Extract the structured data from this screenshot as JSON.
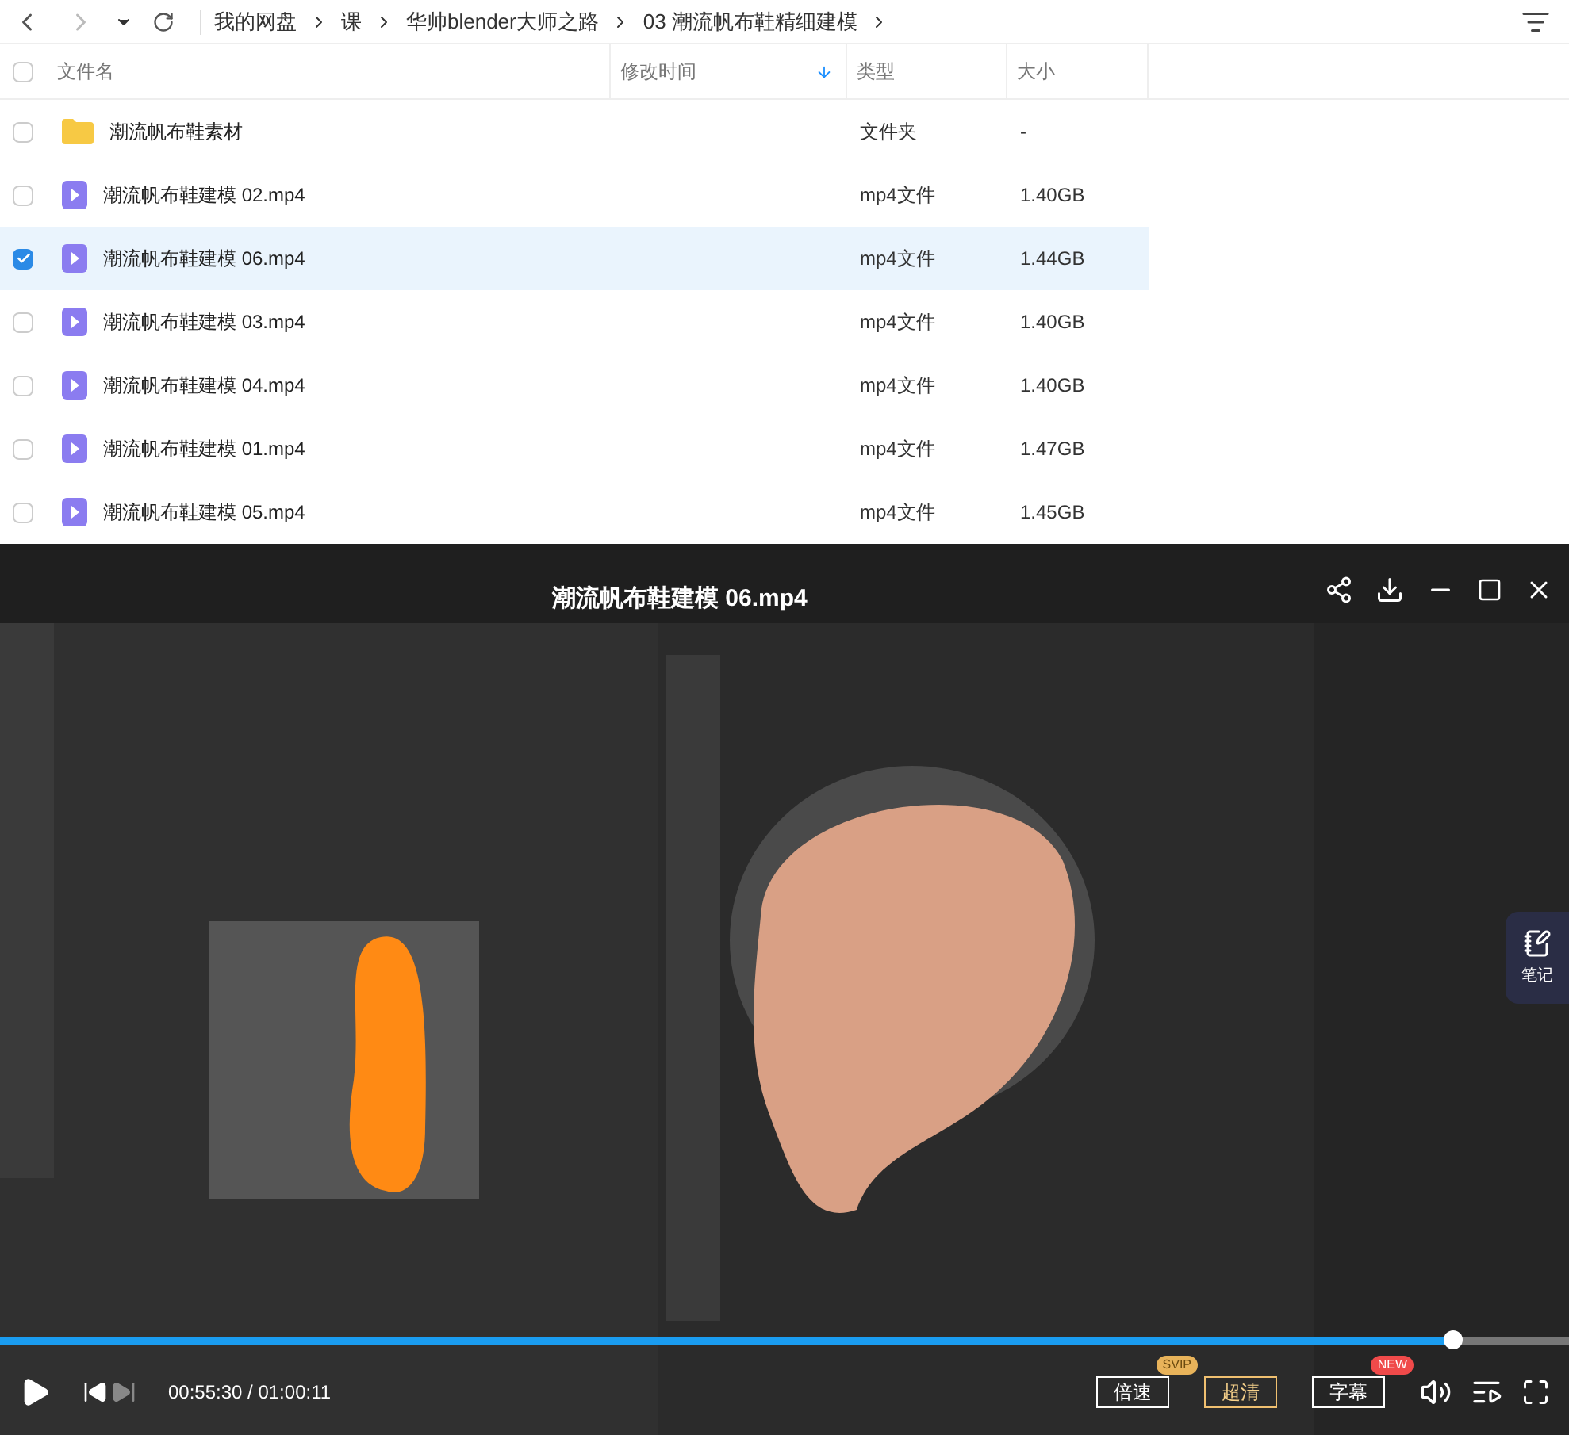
{
  "breadcrumb": [
    "我的网盘",
    "课",
    "华帅blender大师之路",
    "03 潮流帆布鞋精细建模"
  ],
  "table": {
    "columns": [
      {
        "label": "文件名",
        "sorted": false
      },
      {
        "label": "修改时间",
        "sorted": true
      },
      {
        "label": "类型",
        "sorted": false
      },
      {
        "label": "大小",
        "sorted": false
      }
    ],
    "rows": [
      {
        "kind": "folder",
        "name": "潮流帆布鞋素材",
        "type": "文件夹",
        "size": "-",
        "selected": false
      },
      {
        "kind": "video",
        "name": "潮流帆布鞋建模 02.mp4",
        "type": "mp4文件",
        "size": "1.40GB",
        "selected": false
      },
      {
        "kind": "video",
        "name": "潮流帆布鞋建模 06.mp4",
        "type": "mp4文件",
        "size": "1.44GB",
        "selected": true
      },
      {
        "kind": "video",
        "name": "潮流帆布鞋建模 03.mp4",
        "type": "mp4文件",
        "size": "1.40GB",
        "selected": false
      },
      {
        "kind": "video",
        "name": "潮流帆布鞋建模 04.mp4",
        "type": "mp4文件",
        "size": "1.40GB",
        "selected": false
      },
      {
        "kind": "video",
        "name": "潮流帆布鞋建模 01.mp4",
        "type": "mp4文件",
        "size": "1.47GB",
        "selected": false
      },
      {
        "kind": "video",
        "name": "潮流帆布鞋建模 05.mp4",
        "type": "mp4文件",
        "size": "1.45GB",
        "selected": false
      }
    ]
  },
  "player": {
    "title": "潮流帆布鞋建模 06.mp4",
    "progress": {
      "level": 0.926
    },
    "time": "00:55:30 / 01:00:11",
    "buttons": [
      {
        "label": "倍速",
        "badge": "SVIP",
        "highlighted": false
      },
      {
        "label": "超清",
        "highlighted": true
      },
      {
        "label": "字幕",
        "badge": "NEW",
        "highlighted": false
      }
    ],
    "notes_label": "笔记"
  }
}
